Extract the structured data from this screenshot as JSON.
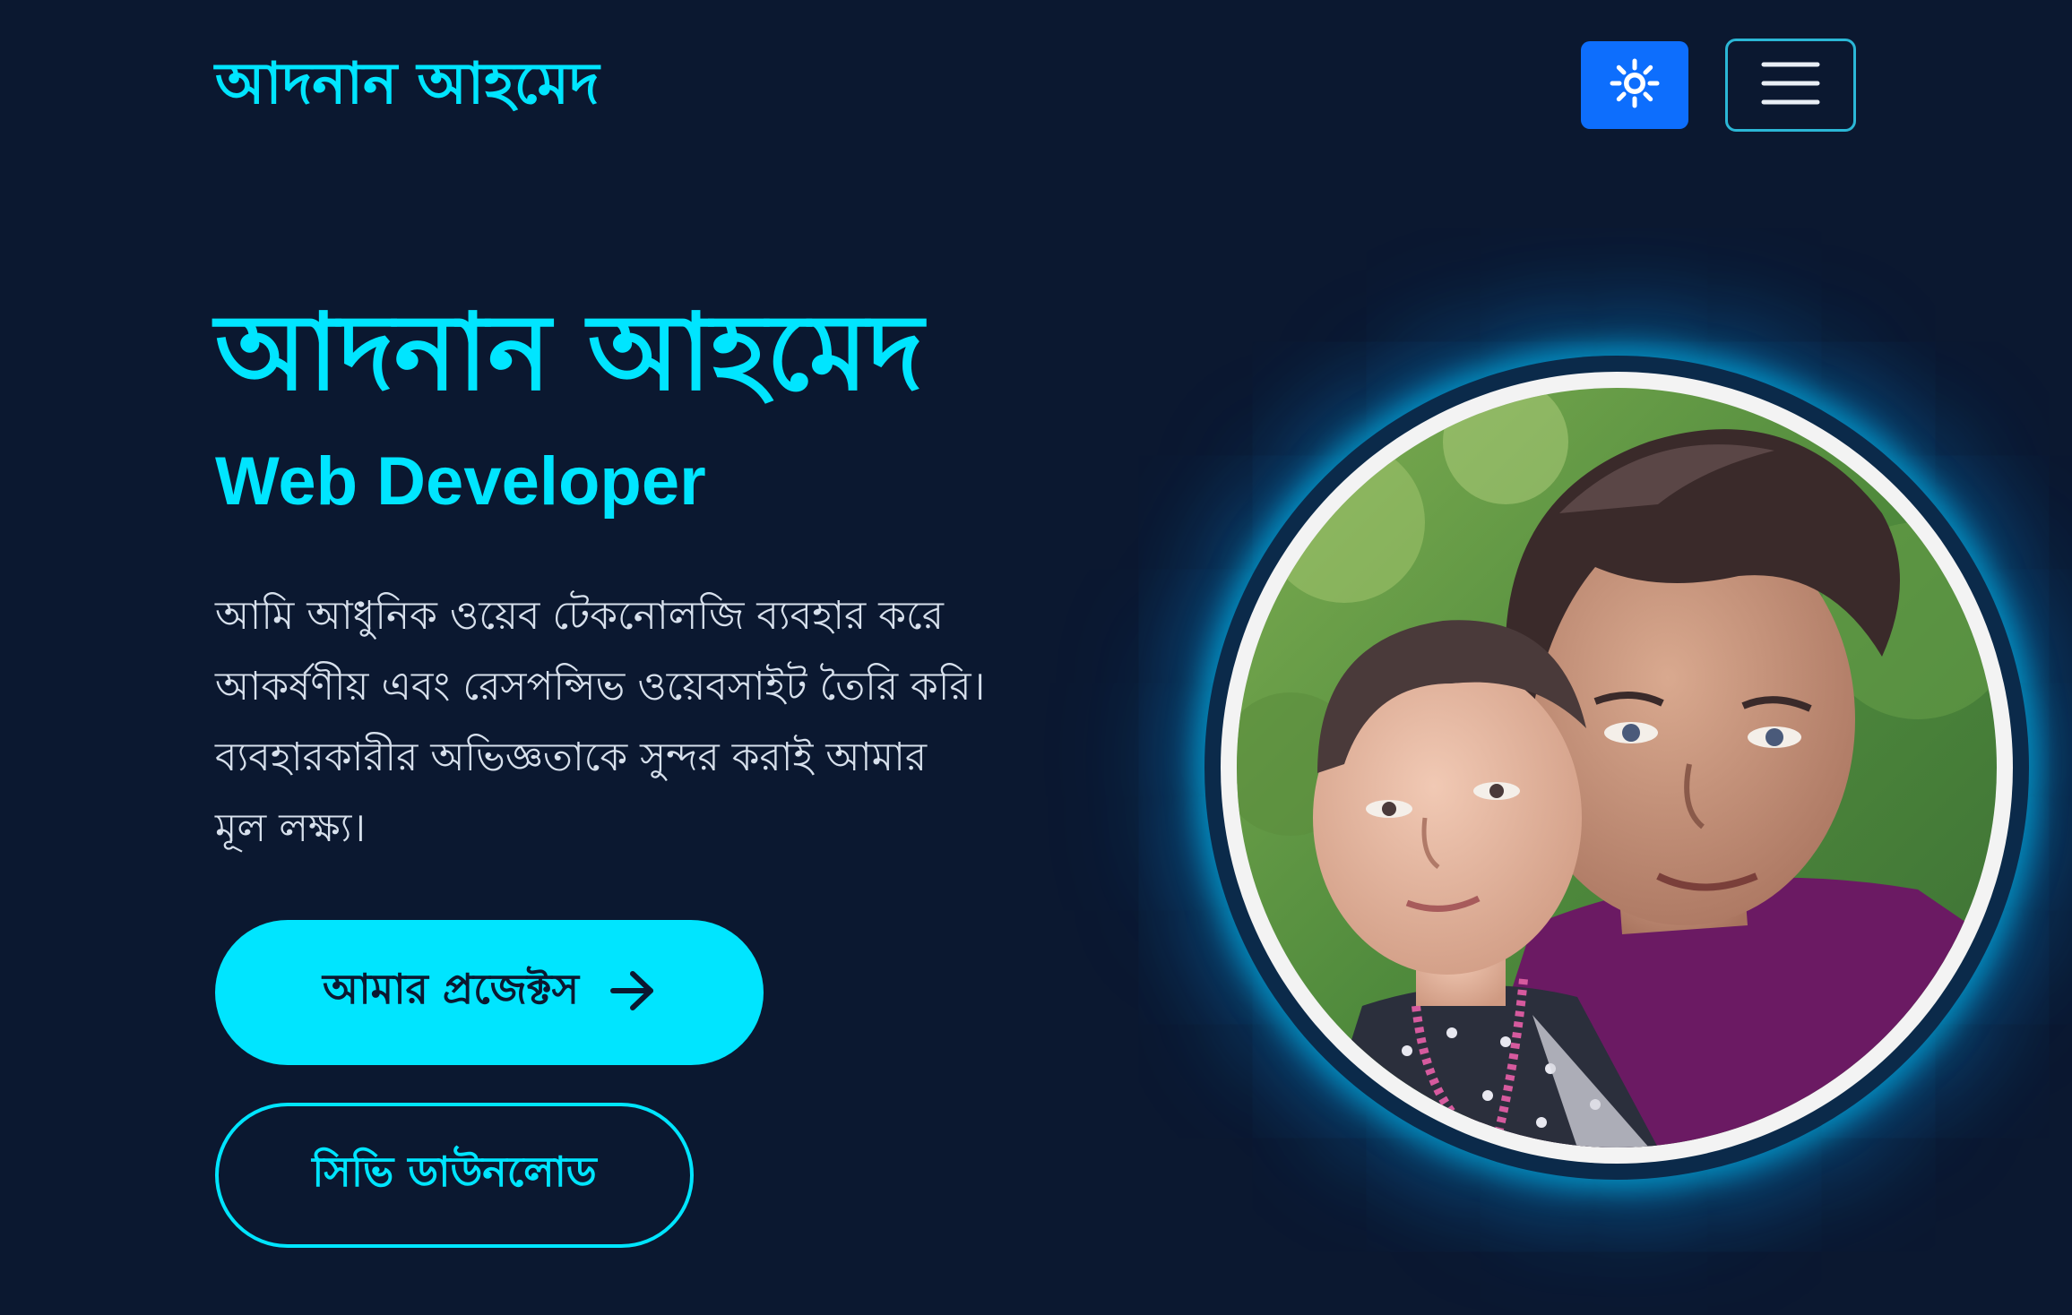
{
  "navbar": {
    "brand": "আদনান আহমেদ",
    "theme_toggle_icon": "sun-icon",
    "menu_icon": "hamburger-menu-icon"
  },
  "hero": {
    "name": "আদনান আহমেদ",
    "role": "Web Developer",
    "description_lines": [
      "আমি আধুনিক ওয়েব টেকনোলজি ব্যবহার করে",
      "আকর্ষণীয় এবং রেসপন্সিভ ওয়েবসাইট তৈরি করি।",
      "ব্যবহারকারীর অভিজ্ঞতাকে সুন্দর করাই আমার",
      "মূল লক্ষ্য।"
    ],
    "primary_button": "আমার প্রজেক্টস",
    "primary_button_icon": "arrow-right-icon",
    "secondary_button": "সিভি ডাউনলোড"
  },
  "colors": {
    "background": "#0b1830",
    "accent": "#00e5ff",
    "theme_button": "#0d6efd"
  }
}
